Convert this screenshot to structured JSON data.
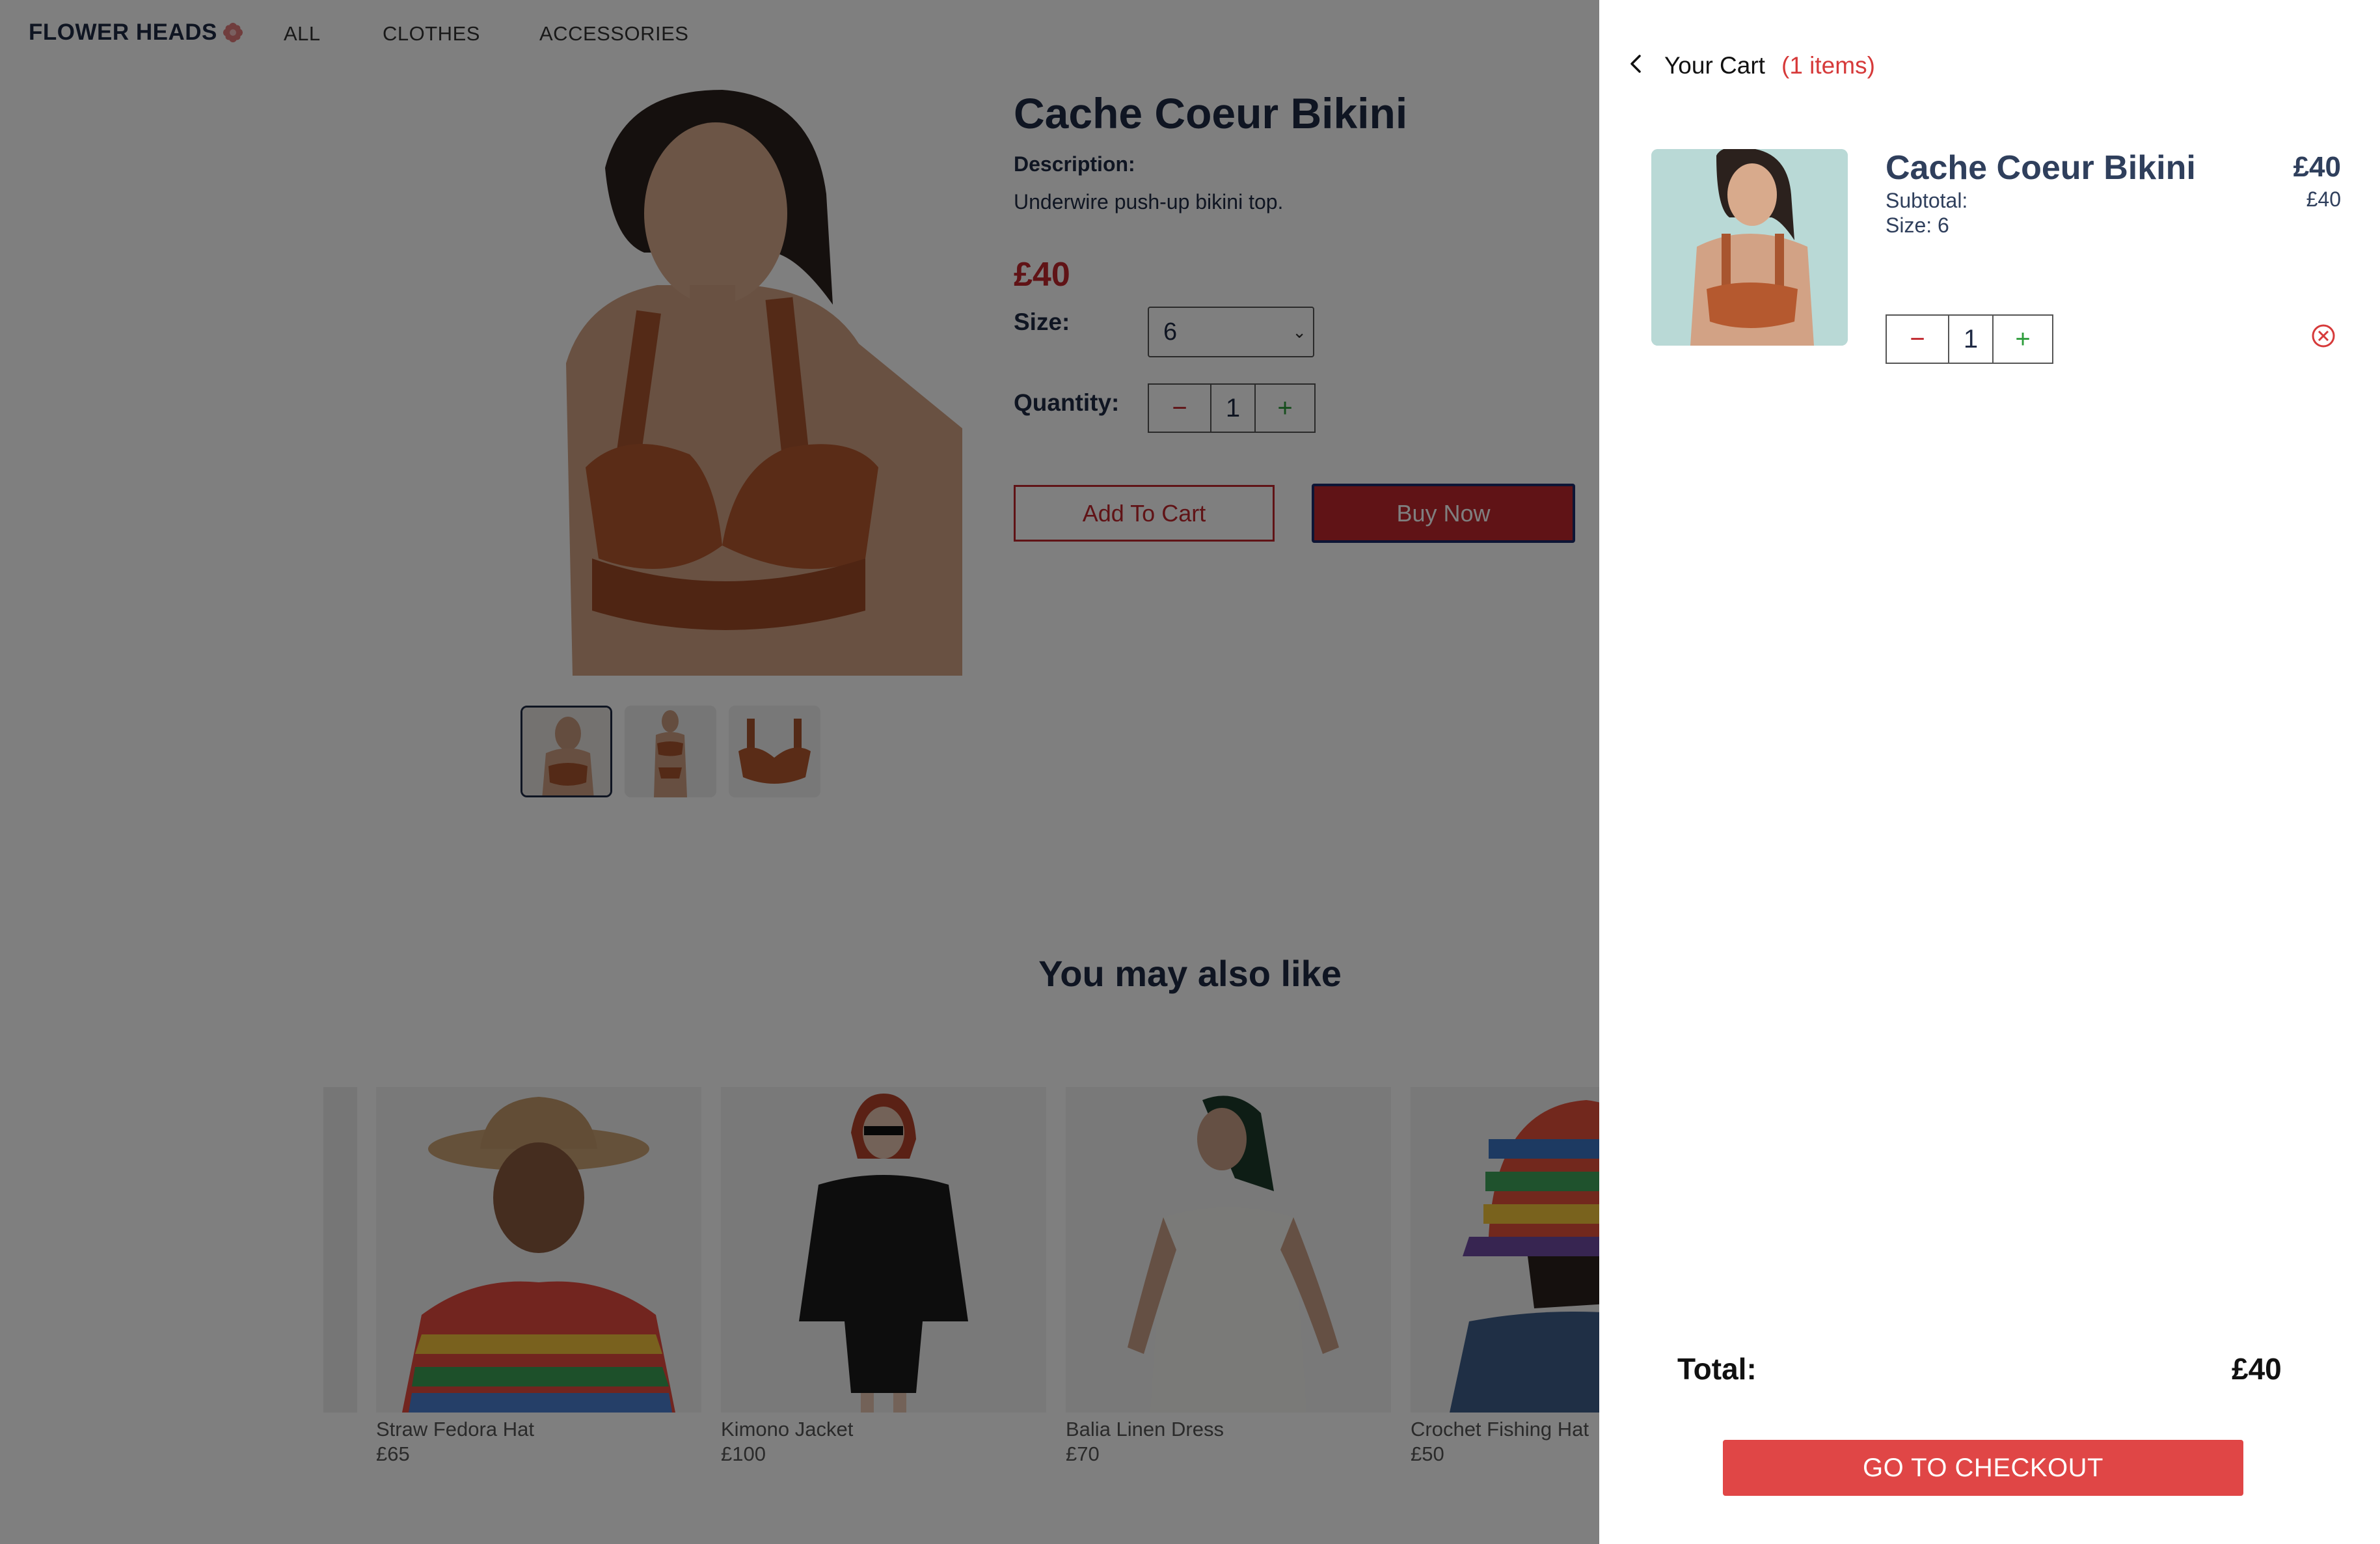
{
  "brand": {
    "name": "FLOWER HEADS"
  },
  "nav": {
    "links": [
      "ALL",
      "CLOTHES",
      "ACCESSORIES"
    ]
  },
  "product": {
    "title": "Cache Coeur Bikini",
    "description_label": "Description:",
    "description": "Underwire push-up bikini top.",
    "price": "£40",
    "size_label": "Size:",
    "size_value": "6",
    "quantity_label": "Quantity:",
    "quantity": "1",
    "add_to_cart": "Add To Cart",
    "buy_now": "Buy Now"
  },
  "recommendations": {
    "heading": "You may also like",
    "items": [
      {
        "name": "Straw Fedora Hat",
        "price": "£65"
      },
      {
        "name": "Kimono Jacket",
        "price": "£100"
      },
      {
        "name": "Balia Linen Dress",
        "price": "£70"
      },
      {
        "name": "Crochet Fishing Hat",
        "price": "£50"
      }
    ]
  },
  "cart": {
    "title": "Your Cart",
    "count": "(1 items)",
    "item": {
      "name": "Cache Coeur Bikini",
      "subtotal_label": "Subtotal:",
      "size": "Size: 6",
      "price": "£40",
      "subtotal_value": "£40",
      "quantity": "1"
    },
    "total_label": "Total:",
    "total_value": "£40",
    "checkout": "GO TO CHECKOUT"
  },
  "colors": {
    "accent": "#c0272d",
    "checkout": "#e04646",
    "navy": "#1f2a44",
    "plus": "#2e9d3c"
  },
  "icons": [
    "flower-icon",
    "chevron-down-icon",
    "minus-icon",
    "plus-icon",
    "back-arrow-icon",
    "remove-circle-icon"
  ]
}
